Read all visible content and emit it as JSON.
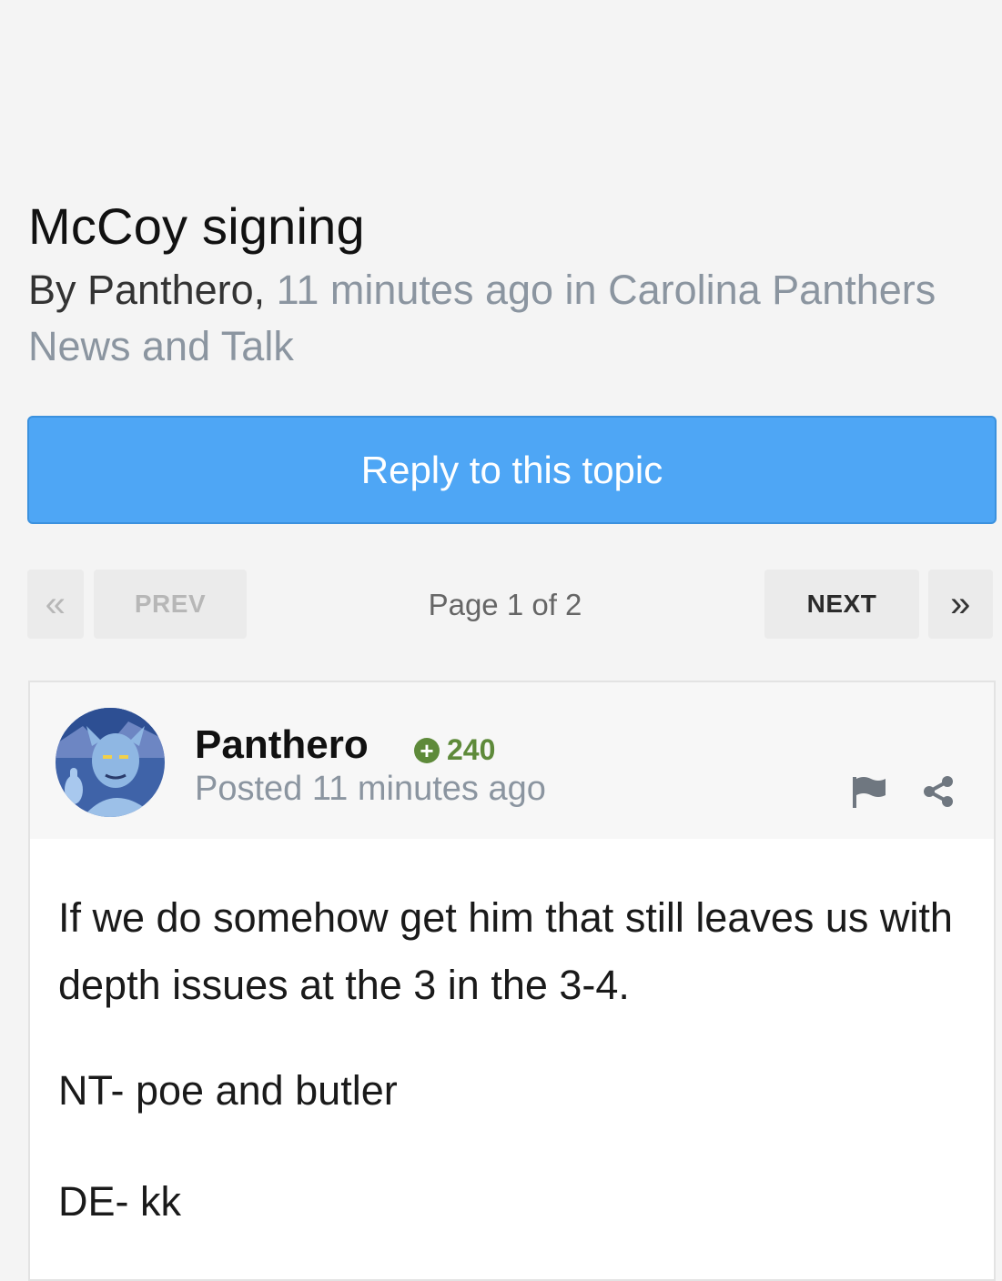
{
  "topic": {
    "title": "McCoy signing",
    "by_prefix": "By Panthero,",
    "meta_rest": "11 minutes ago in Carolina Panthers News and Talk"
  },
  "reply_button": {
    "label": "Reply to this topic"
  },
  "pagination": {
    "first_icon": "«",
    "prev_label": "PREV",
    "page_text": "Page 1 of 2",
    "next_label": "NEXT",
    "last_icon": "»"
  },
  "post": {
    "author": "Panthero",
    "reputation": "240",
    "posted": "Posted 11 minutes ago",
    "body": {
      "p1": "If we do somehow get him that still leaves us with depth issues at the 3 in the 3-4.",
      "p2": "NT- poe and butler",
      "p3": "DE- kk"
    }
  },
  "colors": {
    "accent": "#4ea6f5",
    "muted_text": "#8b95a0",
    "reputation_green": "#5e8a3a"
  },
  "icons": [
    "double-chevron-left-icon",
    "double-chevron-right-icon",
    "plus-circle-icon",
    "flag-icon",
    "share-icon"
  ]
}
